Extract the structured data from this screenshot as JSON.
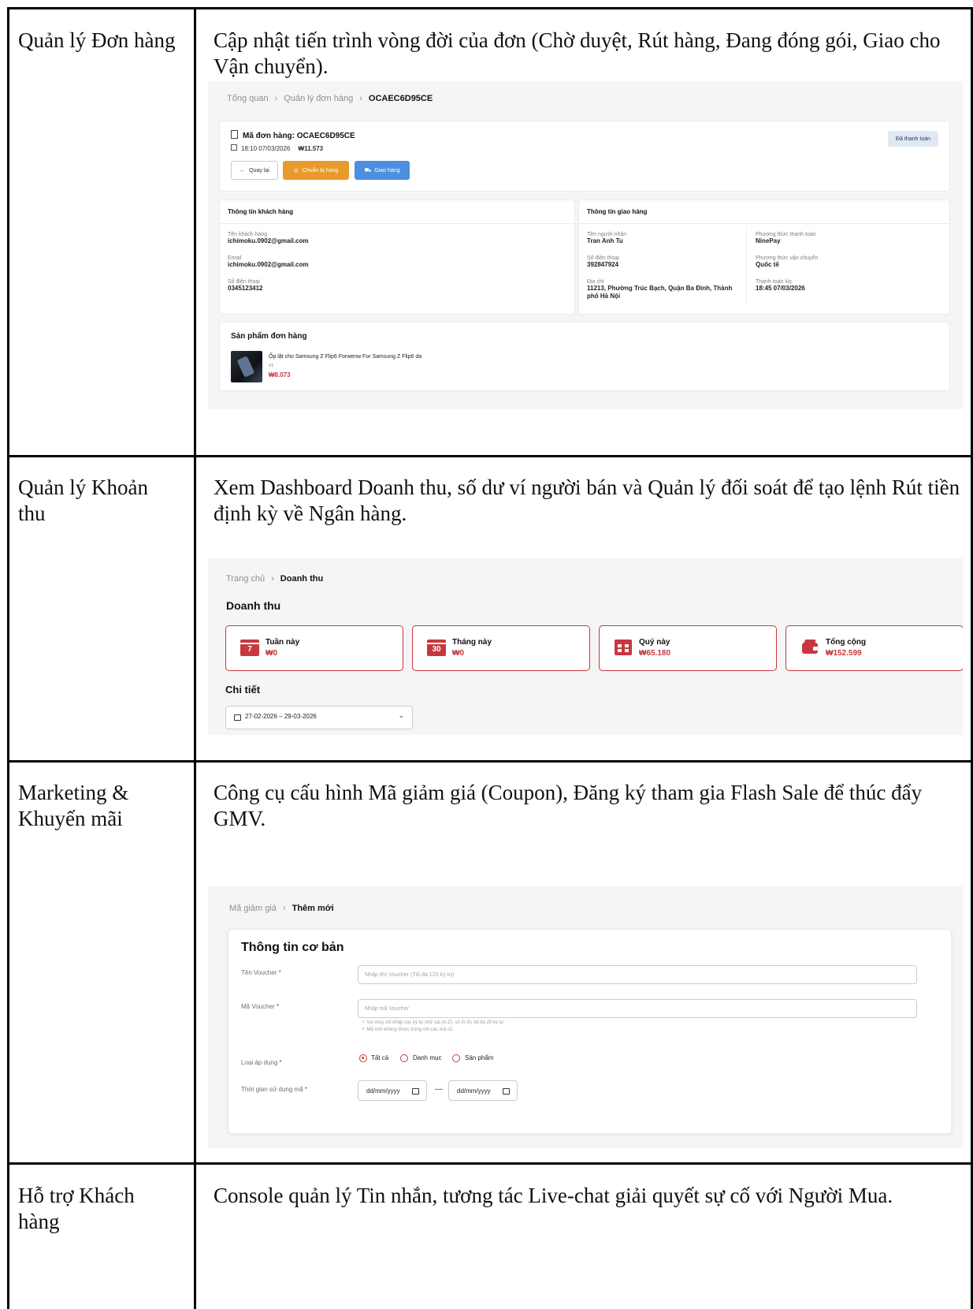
{
  "rows": [
    {
      "feature": "Quản lý Đơn hàng",
      "description": "Cập nhật tiến trình vòng đời của đơn (Chờ duyệt, Rút hàng, Đang đóng gói, Giao cho Vận chuyển)."
    },
    {
      "feature": "Quản lý Khoản thu",
      "description": "Xem Dashboard Doanh thu, số dư ví người bán và Quản lý đối soát để tạo lệnh Rút tiền định kỳ về Ngân hàng."
    },
    {
      "feature": "Marketing & Khuyến mãi",
      "description": "Công cụ cấu hình Mã giảm giá (Coupon), Đăng ký tham gia Flash Sale để thúc đẩy GMV."
    },
    {
      "feature": "Hỗ trợ Khách hàng",
      "description": "Console quản lý Tin nhắn, tương tác Live-chat giải quyết sự cố với Người Mua."
    }
  ],
  "order": {
    "breadcrumb": [
      "Tổng quan",
      "Quản lý đơn hàng",
      "OCAEC6D95CE"
    ],
    "order_code_label": "Mã đơn hàng: OCAEC6D95CE",
    "datetime": "18:10 07/03/2026",
    "total": "₩11.573",
    "status_badge": "Đã thanh toán",
    "buttons": {
      "back": "Quay lại",
      "prepare": "Chuẩn bị hàng",
      "ship": "Giao hàng"
    },
    "customer": {
      "title": "Thông tin khách hàng",
      "name_label": "Tên khách hàng",
      "name": "ichimoku.0902@gmail.com",
      "email_label": "Email",
      "email": "ichimoku.0902@gmail.com",
      "phone_label": "Số điện thoại",
      "phone": "0345123412"
    },
    "shipping": {
      "title": "Thông tin giao hàng",
      "recipient_label": "Tên người nhận",
      "recipient": "Tran Anh Tu",
      "phone_label": "Số điện thoại",
      "phone": "392847924",
      "address_label": "Địa chỉ",
      "address": "11213, Phường Trúc Bạch, Quận Ba Đình, Thành phố Hà Nội",
      "payment_method_label": "Phương thức thanh toán",
      "payment_method": "NinePay",
      "shipping_method_label": "Phương thức vận chuyển",
      "shipping_method": "Quốc tế",
      "paid_at_label": "Thanh toán lúc",
      "paid_at": "18:45 07/03/2026"
    },
    "products": {
      "title": "Sản phẩm đơn hàng",
      "item_name": "Ốp lật cho Samsung Z Flip6 Forwenw For Samsung Z Flip6 da",
      "qty": "x1",
      "price": "₩8.073"
    }
  },
  "revenue": {
    "breadcrumb": [
      "Trang chủ",
      "Doanh thu"
    ],
    "title": "Doanh thu",
    "cards": [
      {
        "label": "Tuần này",
        "value": "₩0",
        "icon_text": "7",
        "icon": "calendar-week-icon"
      },
      {
        "label": "Tháng này",
        "value": "₩0",
        "icon_text": "30",
        "icon": "calendar-month-icon"
      },
      {
        "label": "Quý này",
        "value": "₩65.180",
        "icon": "calendar-grid-icon"
      },
      {
        "label": "Tổng cộng",
        "value": "₩152.599",
        "icon": "wallet-icon"
      }
    ],
    "detail_title": "Chi tiết",
    "date_range": "27-02-2026 – 29-03-2026"
  },
  "voucher": {
    "breadcrumb": [
      "Mã giảm giá",
      "Thêm mới"
    ],
    "section_title": "Thông tin cơ bản",
    "name_label": "Tên Voucher",
    "name_placeholder": "Nhập tên Voucher (Tối đa 120 ký tự)",
    "code_label": "Mã Voucher",
    "code_placeholder": "Nhập mã Voucher",
    "hint1": "Vui lòng chỉ nhập các ký tự chữ cái (A-Z), số (0-9); tối đa 20 ký tự.",
    "hint2": "Mã mới không được trùng với các mã cũ.",
    "apply_label": "Loại áp dụng",
    "apply_options": [
      "Tất cả",
      "Danh mục",
      "Sản phẩm"
    ],
    "time_label": "Thời gian sử dụng mã",
    "date_placeholder": "dd/mm/yyyy",
    "date_separator": "—",
    "required_mark": "*"
  },
  "colors": {
    "accent": "#c7373f",
    "orange": "#e89a2a",
    "blue": "#4c8ee0",
    "badge_bg": "#dfe8f3"
  }
}
